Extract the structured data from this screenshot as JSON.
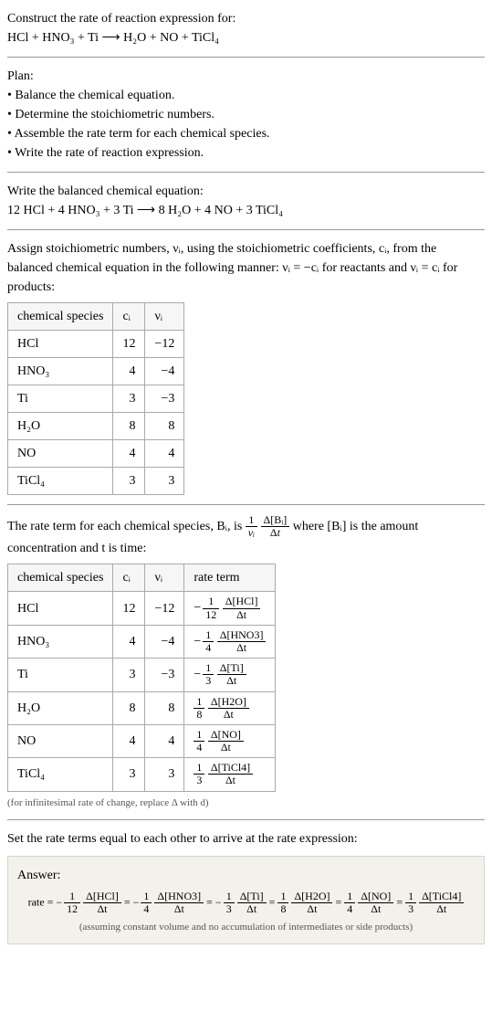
{
  "intro": {
    "line1": "Construct the rate of reaction expression for:",
    "equation": "HCl + HNO₃ + Ti ⟶ H₂O + NO + TiCl₄"
  },
  "plan": {
    "title": "Plan:",
    "items": [
      "Balance the chemical equation.",
      "Determine the stoichiometric numbers.",
      "Assemble the rate term for each chemical species.",
      "Write the rate of reaction expression."
    ]
  },
  "balanced": {
    "title": "Write the balanced chemical equation:",
    "equation": "12 HCl + 4 HNO₃ + 3 Ti ⟶ 8 H₂O + 4 NO + 3 TiCl₄"
  },
  "stoich": {
    "intro": "Assign stoichiometric numbers, νᵢ, using the stoichiometric coefficients, cᵢ, from the balanced chemical equation in the following manner: νᵢ = −cᵢ for reactants and νᵢ = cᵢ for products:",
    "headers": {
      "species": "chemical species",
      "c": "cᵢ",
      "v": "νᵢ"
    },
    "rows": [
      {
        "species": "HCl",
        "c": "12",
        "v": "−12"
      },
      {
        "species": "HNO₃",
        "c": "4",
        "v": "−4"
      },
      {
        "species": "Ti",
        "c": "3",
        "v": "−3"
      },
      {
        "species": "H₂O",
        "c": "8",
        "v": "8"
      },
      {
        "species": "NO",
        "c": "4",
        "v": "4"
      },
      {
        "species": "TiCl₄",
        "c": "3",
        "v": "3"
      }
    ]
  },
  "rateterm": {
    "intro_a": "The rate term for each chemical species, Bᵢ, is ",
    "intro_b": " where [Bᵢ] is the amount concentration and t is time:",
    "headers": {
      "species": "chemical species",
      "c": "cᵢ",
      "v": "νᵢ",
      "rate": "rate term"
    },
    "rows": [
      {
        "species": "HCl",
        "c": "12",
        "v": "−12",
        "sign": "−",
        "coef_n": "1",
        "coef_d": "12",
        "conc": "Δ[HCl]"
      },
      {
        "species": "HNO₃",
        "c": "4",
        "v": "−4",
        "sign": "−",
        "coef_n": "1",
        "coef_d": "4",
        "conc": "Δ[HNO3]"
      },
      {
        "species": "Ti",
        "c": "3",
        "v": "−3",
        "sign": "−",
        "coef_n": "1",
        "coef_d": "3",
        "conc": "Δ[Ti]"
      },
      {
        "species": "H₂O",
        "c": "8",
        "v": "8",
        "sign": "",
        "coef_n": "1",
        "coef_d": "8",
        "conc": "Δ[H2O]"
      },
      {
        "species": "NO",
        "c": "4",
        "v": "4",
        "sign": "",
        "coef_n": "1",
        "coef_d": "4",
        "conc": "Δ[NO]"
      },
      {
        "species": "TiCl₄",
        "c": "3",
        "v": "3",
        "sign": "",
        "coef_n": "1",
        "coef_d": "3",
        "conc": "Δ[TiCl4]"
      }
    ],
    "footnote": "(for infinitesimal rate of change, replace Δ with d)"
  },
  "final": {
    "title": "Set the rate terms equal to each other to arrive at the rate expression:",
    "answer_title": "Answer:",
    "rate_label": "rate",
    "terms": [
      {
        "sign": "−",
        "coef_n": "1",
        "coef_d": "12",
        "conc": "Δ[HCl]"
      },
      {
        "sign": "−",
        "coef_n": "1",
        "coef_d": "4",
        "conc": "Δ[HNO3]"
      },
      {
        "sign": "−",
        "coef_n": "1",
        "coef_d": "3",
        "conc": "Δ[Ti]"
      },
      {
        "sign": "",
        "coef_n": "1",
        "coef_d": "8",
        "conc": "Δ[H2O]"
      },
      {
        "sign": "",
        "coef_n": "1",
        "coef_d": "4",
        "conc": "Δ[NO]"
      },
      {
        "sign": "",
        "coef_n": "1",
        "coef_d": "3",
        "conc": "Δ[TiCl4]"
      }
    ],
    "note": "(assuming constant volume and no accumulation of intermediates or side products)"
  },
  "dt": "Δt",
  "chart_data": {
    "type": "table",
    "title": "Stoichiometric coefficients and rate terms",
    "series": [
      {
        "name": "cᵢ",
        "categories": [
          "HCl",
          "HNO₃",
          "Ti",
          "H₂O",
          "NO",
          "TiCl₄"
        ],
        "values": [
          12,
          4,
          3,
          8,
          4,
          3
        ]
      },
      {
        "name": "νᵢ",
        "categories": [
          "HCl",
          "HNO₃",
          "Ti",
          "H₂O",
          "NO",
          "TiCl₄"
        ],
        "values": [
          -12,
          -4,
          -3,
          8,
          4,
          3
        ]
      }
    ]
  }
}
